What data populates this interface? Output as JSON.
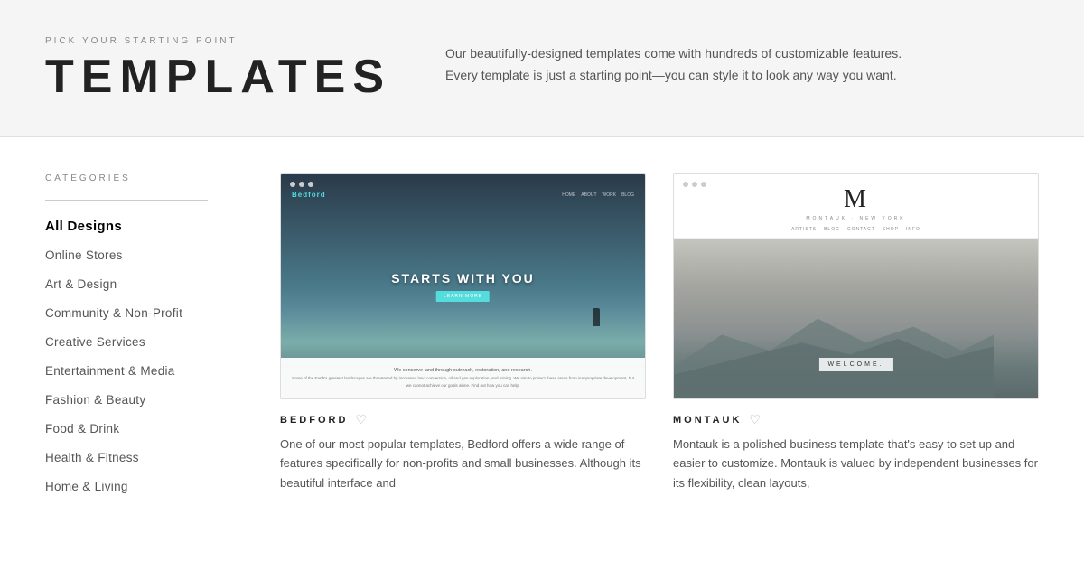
{
  "header": {
    "subtitle": "PICK YOUR STARTING POINT",
    "title": "TEMPLATES",
    "description": "Our beautifully-designed templates come with hundreds of customizable features. Every template is just a starting point—you can style it to look any way you want."
  },
  "sidebar": {
    "categories_label": "CATEGORIES",
    "items": [
      {
        "id": "all-designs",
        "label": "All Designs",
        "active": true
      },
      {
        "id": "online-stores",
        "label": "Online Stores",
        "active": false
      },
      {
        "id": "art-design",
        "label": "Art & Design",
        "active": false
      },
      {
        "id": "community-non-profit",
        "label": "Community & Non-Profit",
        "active": false
      },
      {
        "id": "creative-services",
        "label": "Creative Services",
        "active": false
      },
      {
        "id": "entertainment-media",
        "label": "Entertainment & Media",
        "active": false
      },
      {
        "id": "fashion-beauty",
        "label": "Fashion & Beauty",
        "active": false
      },
      {
        "id": "food-drink",
        "label": "Food & Drink",
        "active": false
      },
      {
        "id": "health-fitness",
        "label": "Health & Fitness",
        "active": false
      },
      {
        "id": "home-living",
        "label": "Home & Living",
        "active": false
      }
    ]
  },
  "templates": [
    {
      "id": "bedford",
      "name": "BEDFORD",
      "description": "One of our most popular templates, Bedford offers a wide range of features specifically for non-profits and small businesses. Although its beautiful interface and"
    },
    {
      "id": "montauk",
      "name": "MONTAUK",
      "description": "Montauk is a polished business template that's easy to set up and easier to customize. Montauk is valued by independent businesses for its flexibility, clean layouts,"
    }
  ],
  "icons": {
    "heart": "♡"
  }
}
